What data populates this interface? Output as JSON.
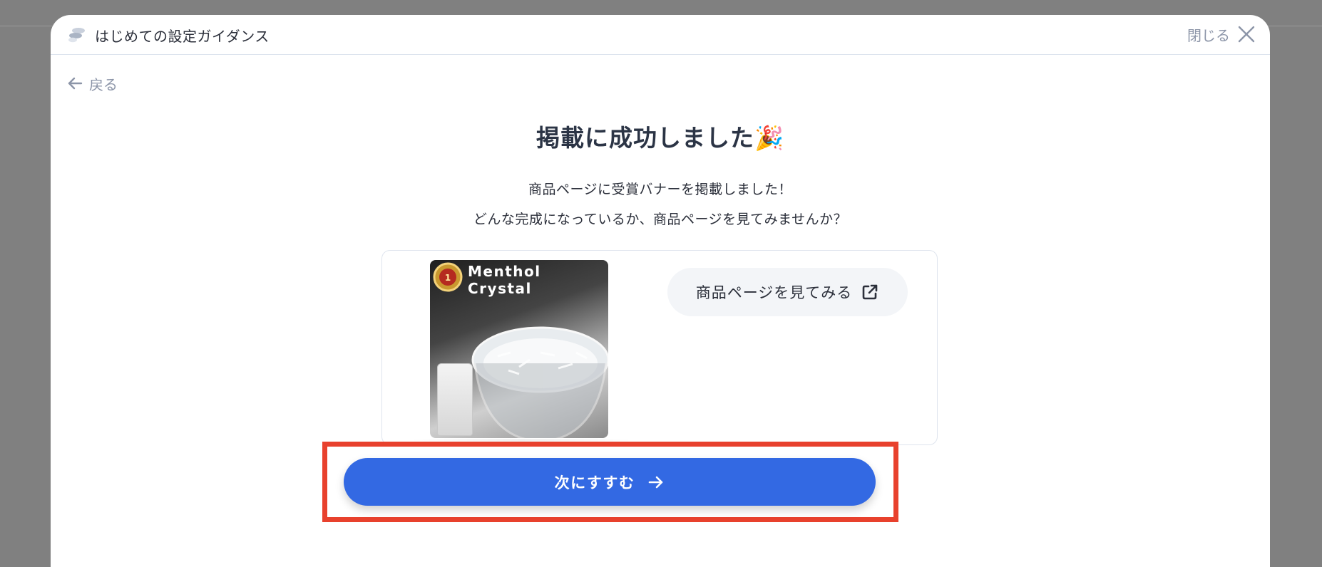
{
  "modal": {
    "title": "はじめての設定ガイダンス",
    "close_label": "閉じる",
    "back_label": "戻る"
  },
  "content": {
    "headline": "掲載に成功しました🎉",
    "description_line1": "商品ページに受賞バナーを掲載しました！",
    "description_line2": "どんな完成になっているか、商品ページを見てみませんか？"
  },
  "product_card": {
    "image_text": "Menthol Crystal",
    "view_page_label": "商品ページを見てみる"
  },
  "next_button": {
    "label": "次にすすむ"
  },
  "colors": {
    "primary": "#3369e3",
    "highlight": "#e8412d",
    "muted_text": "#8c95a8",
    "overlay": "#808080"
  }
}
